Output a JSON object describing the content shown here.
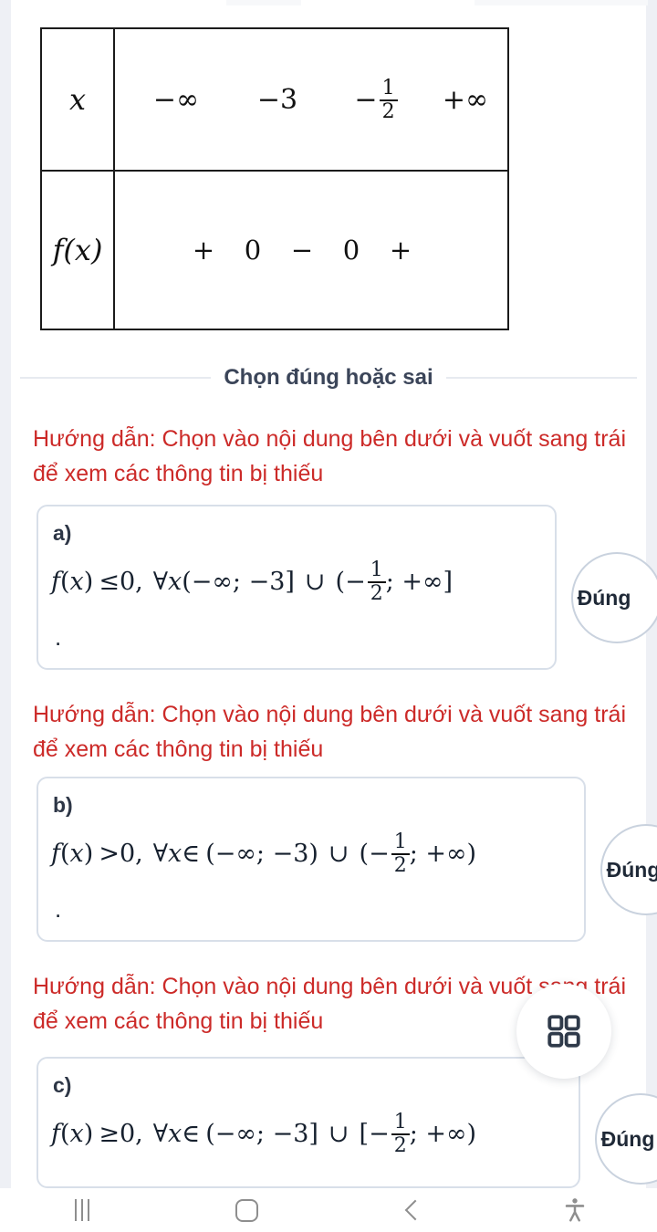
{
  "sign_table": {
    "row_labels": [
      "x",
      "f(x)"
    ],
    "x_values": [
      "−∞",
      "−3",
      "−½",
      "+∞"
    ],
    "x_values_display": [
      {
        "text": "−∞"
      },
      {
        "text": "−3"
      },
      {
        "text": "−",
        "fraction": {
          "num": "1",
          "den": "2"
        }
      },
      {
        "text": "+∞"
      }
    ],
    "f_signs": [
      "+",
      "0",
      "−",
      "0",
      "+"
    ]
  },
  "section": {
    "divider_label": "Chọn đúng hoặc sai"
  },
  "hints": [
    "Hướng dẫn: Chọn vào nội dung bên dưới và vuốt sang trái để xem các thông tin bị thiếu",
    "Hướng dẫn: Chọn vào nội dung bên dưới và vuốt sang trái để xem các thông tin bị thiếu",
    "Hướng dẫn: Chọn vào nội dung bên dưới và vuốt sang trái để xem các thông tin bị thiếu"
  ],
  "questions": [
    {
      "label": "a)",
      "expression": "f(x) ≤ 0, ∀x(−∞; −3] ∪ (− 1/2 ; +∞]",
      "parts": {
        "fx": "f",
        "open": "(",
        "var": "x",
        "close": ")",
        "relation": "≤",
        "zero": "0,",
        "forall": "∀",
        "var2": "x",
        "member": "",
        "interval1": "(−∞; −3]",
        "union": "∪",
        "interval2_open": "(−",
        "frac_num": "1",
        "frac_den": "2",
        "interval2_tail": "; +∞]"
      },
      "trailing_dot": ".",
      "button_label": "Đúng"
    },
    {
      "label": "b)",
      "expression": "f(x) > 0, ∀x ∈ (−∞; −3) ∪ (− 1/2 ; +∞)",
      "parts": {
        "fx": "f",
        "open": "(",
        "var": "x",
        "close": ")",
        "relation": ">",
        "zero": "0,",
        "forall": "∀",
        "var2": "x",
        "member": "∈",
        "interval1": "(−∞; −3)",
        "union": "∪",
        "interval2_open": "(−",
        "frac_num": "1",
        "frac_den": "2",
        "interval2_tail": "; +∞)"
      },
      "trailing_dot": ".",
      "button_label": "Đúng"
    },
    {
      "label": "c)",
      "expression": "f(x) ≥ 0, ∀x ∈ (−∞; −3] ∪ [− 1/2 ; +∞)",
      "parts": {
        "fx": "f",
        "open": "(",
        "var": "x",
        "close": ")",
        "relation": "≥",
        "zero": "0,",
        "forall": "∀",
        "var2": "x",
        "member": "∈",
        "interval1": "(−∞; −3]",
        "union": "∪",
        "interval2_open": "[−",
        "frac_num": "1",
        "frac_den": "2",
        "interval2_tail": "; +∞)"
      },
      "trailing_dot": "",
      "button_label": "Đúng"
    }
  ],
  "fab": {
    "icon": "grid-2x2-icon"
  },
  "navbar": {
    "items": [
      {
        "icon": "recents-icon"
      },
      {
        "icon": "home-icon"
      },
      {
        "icon": "back-icon"
      },
      {
        "icon": "accessibility-icon"
      }
    ]
  },
  "colors": {
    "hint_red": "#cc2a28",
    "divider_label": "#3b4559",
    "card_border": "#d8dfe9",
    "page_bg": "#eef0f5"
  }
}
